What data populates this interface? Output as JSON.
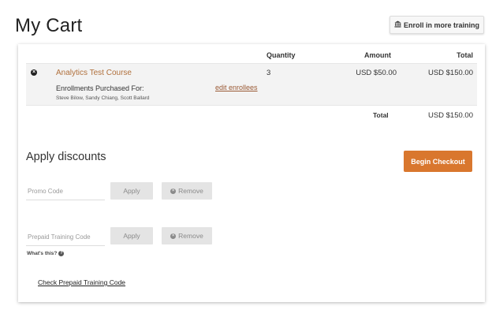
{
  "header": {
    "title": "My Cart",
    "enroll_button_label": "Enroll in more training",
    "enroll_button_icon": "institution-icon"
  },
  "table": {
    "columns": [
      "",
      "",
      "Quantity",
      "Amount",
      "Total"
    ],
    "rows": [
      {
        "course": "Analytics Test Course",
        "quantity": "3",
        "amount": "USD $50.00",
        "total": "USD $150.00",
        "enrollments_label": "Enrollments Purchased For:",
        "enrollees": "Steve Bilow, Sandy Chiang, Scott Ballard",
        "edit_link": "edit enrollees"
      }
    ],
    "total_label": "Total",
    "total_value": "USD $150.00"
  },
  "discounts": {
    "title": "Apply discounts",
    "checkout_label": "Begin Checkout",
    "promo": {
      "placeholder": "Promo Code",
      "apply_label": "Apply",
      "remove_label": "Remove"
    },
    "prepaid": {
      "placeholder": "Prepaid Training Code",
      "apply_label": "Apply",
      "remove_label": "Remove",
      "whats_this": "What's this?"
    },
    "check_link": "Check Prepaid Training Code"
  },
  "colors": {
    "accent": "#d9772e",
    "link": "#b0703c"
  }
}
